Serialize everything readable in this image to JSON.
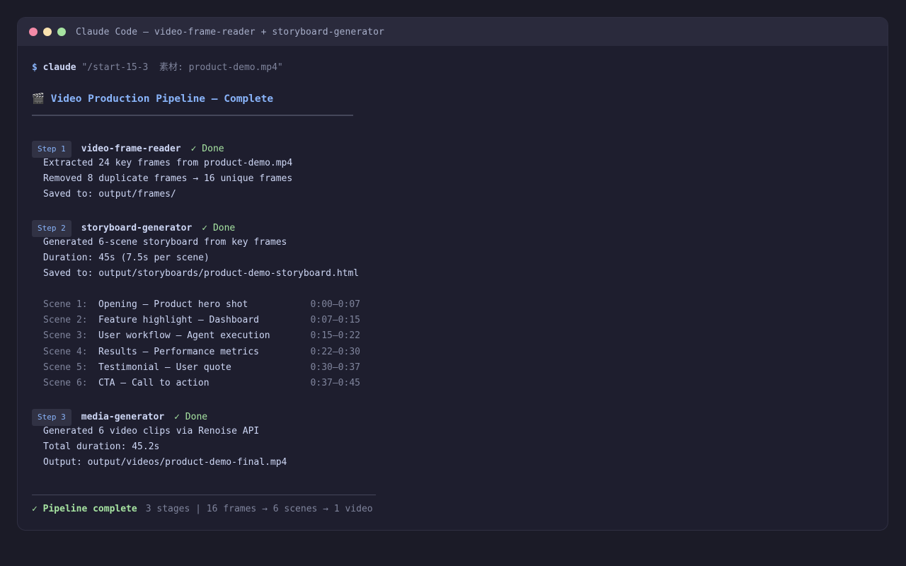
{
  "window": {
    "title": "Claude Code — video-frame-reader + storyboard-generator"
  },
  "prompt": {
    "dollar": "$",
    "command": "claude",
    "argument": "\"/start-15-3  素材: product-demo.mp4\""
  },
  "heading": {
    "icon": "clapper-board-icon",
    "glyph": "🎬",
    "text": "Video Production Pipeline — Complete"
  },
  "steps": [
    {
      "badge": "Step 1",
      "name": "video-frame-reader",
      "status": "✓ Done",
      "details": [
        "Extracted 24 key frames from product-demo.mp4",
        "Removed 8 duplicate frames → 16 unique frames",
        "Saved to: output/frames/"
      ]
    },
    {
      "badge": "Step 2",
      "name": "storyboard-generator",
      "status": "✓ Done",
      "details": [
        "Generated 6-scene storyboard from key frames",
        "Duration: 45s (7.5s per scene)",
        "Saved to: output/storyboards/product-demo-storyboard.html"
      ],
      "scenes": [
        {
          "label": "Scene 1:",
          "desc": "Opening — Product hero shot",
          "time": "0:00–0:07"
        },
        {
          "label": "Scene 2:",
          "desc": "Feature highlight — Dashboard",
          "time": "0:07–0:15"
        },
        {
          "label": "Scene 3:",
          "desc": "User workflow — Agent execution",
          "time": "0:15–0:22"
        },
        {
          "label": "Scene 4:",
          "desc": "Results — Performance metrics",
          "time": "0:22–0:30"
        },
        {
          "label": "Scene 5:",
          "desc": "Testimonial — User quote",
          "time": "0:30–0:37"
        },
        {
          "label": "Scene 6:",
          "desc": "CTA — Call to action",
          "time": "0:37–0:45"
        }
      ]
    },
    {
      "badge": "Step 3",
      "name": "media-generator",
      "status": "✓ Done",
      "details": [
        "Generated 6 video clips via Renoise API",
        "Total duration: 45.2s",
        "Output: output/videos/product-demo-final.mp4"
      ]
    }
  ],
  "summary": {
    "status": "✓ Pipeline complete",
    "stats": "3 stages | 16 frames → 6 scenes → 1 video"
  },
  "colors": {
    "background": "#1b1b27",
    "window": "#1e1e2e",
    "titlebar": "#2a2a3c",
    "accent_blue": "#89b4fa",
    "success_green": "#a6e3a1",
    "muted": "#7f849c",
    "text": "#cdd6f4"
  }
}
